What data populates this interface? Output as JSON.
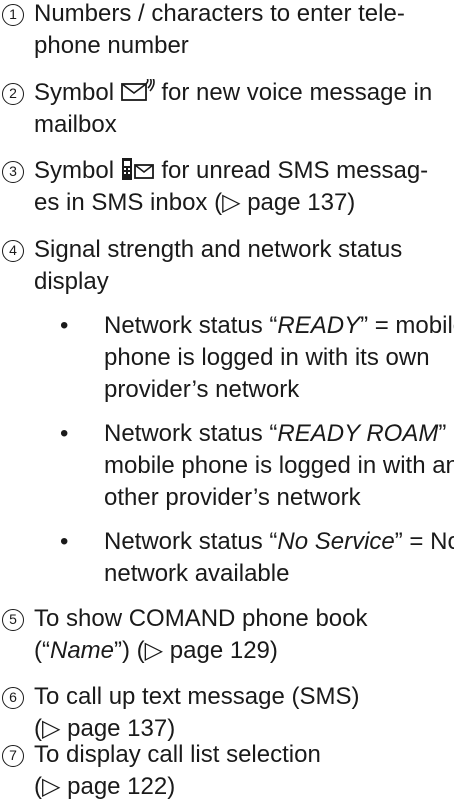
{
  "items": [
    {
      "n": "1",
      "lines": [
        "Numbers / characters to enter tele-",
        "phone number"
      ]
    },
    {
      "n": "2",
      "lines": [
        "Symbol",
        "for new voice message in",
        "mailbox"
      ]
    },
    {
      "n": "3",
      "lines": [
        "Symbol",
        "for unread SMS messag-",
        "es in SMS inbox (▷ page 137)"
      ]
    },
    {
      "n": "4",
      "lines": [
        "Signal strength and network status",
        "display"
      ]
    },
    {
      "n": "5",
      "lines": [
        "To show COMAND phone book",
        "(“",
        "Name",
        "”) (▷ page 129)"
      ]
    },
    {
      "n": "6",
      "lines": [
        "To call up text message (SMS)",
        "(▷ page 137)"
      ]
    },
    {
      "n": "7",
      "lines": [
        "To display call list selection",
        "(▷ page 122)"
      ]
    }
  ],
  "bullets": [
    {
      "pre": "Network status “",
      "status": "READY",
      "post": "” = mobile",
      "l2": "phone is logged in with its own",
      "l3": "provider’s network"
    },
    {
      "pre": "Network status “",
      "status": "READY ROAM",
      "post": "” =",
      "l2": "mobile phone is logged in with an-",
      "l3": "other provider’s network"
    },
    {
      "pre": "Network status “",
      "status": "No Service",
      "post": "” = No",
      "l2": "network available"
    }
  ],
  "icons": [
    "voice-mailbox-icon",
    "sms-inbox-icon"
  ]
}
